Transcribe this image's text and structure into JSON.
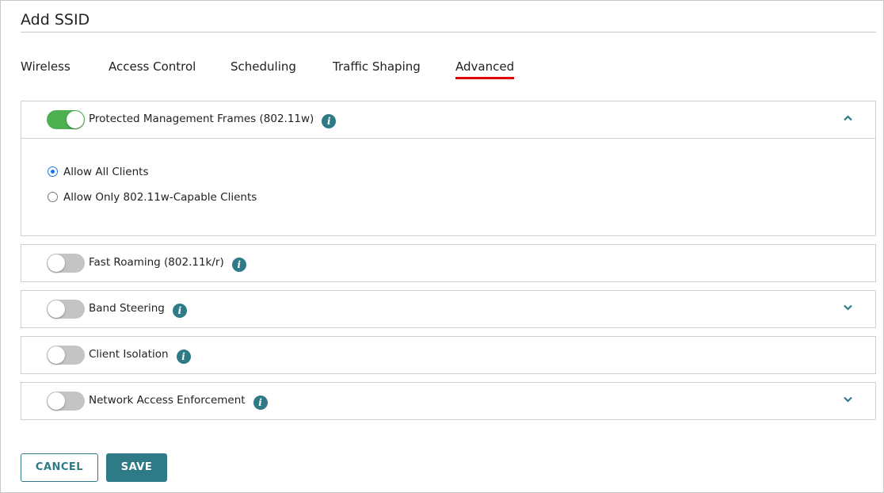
{
  "title": "Add SSID",
  "tabs": [
    {
      "label": "Wireless",
      "active": false
    },
    {
      "label": "Access Control",
      "active": false
    },
    {
      "label": "Scheduling",
      "active": false
    },
    {
      "label": "Traffic Shaping",
      "active": false
    },
    {
      "label": "Advanced",
      "active": true
    }
  ],
  "colors": {
    "accent": "#2f7a87",
    "active_tab_underline": "#e00000",
    "toggle_on": "#4caf50",
    "toggle_off": "#c4c4c4",
    "radio_selected": "#1a73e8"
  },
  "panels": [
    {
      "label": "Protected Management Frames (802.11w)",
      "enabled": true,
      "info_icon": "info-icon",
      "chevron": "chevron-up-icon",
      "expanded": true,
      "options": [
        {
          "label": "Allow All Clients",
          "selected": true
        },
        {
          "label": "Allow Only 802.11w-Capable Clients",
          "selected": false
        }
      ]
    },
    {
      "label": "Fast Roaming (802.11k/r)",
      "enabled": false,
      "info_icon": "info-icon",
      "chevron": null,
      "expanded": false
    },
    {
      "label": "Band Steering",
      "enabled": false,
      "info_icon": "info-icon",
      "chevron": "chevron-down-icon",
      "expanded": false
    },
    {
      "label": "Client Isolation",
      "enabled": false,
      "info_icon": "info-icon",
      "chevron": null,
      "expanded": false
    },
    {
      "label": "Network Access Enforcement",
      "enabled": false,
      "info_icon": "info-icon",
      "chevron": "chevron-down-icon",
      "expanded": false
    }
  ],
  "buttons": {
    "cancel": "CANCEL",
    "save": "SAVE"
  },
  "icons": {
    "info": "i"
  }
}
